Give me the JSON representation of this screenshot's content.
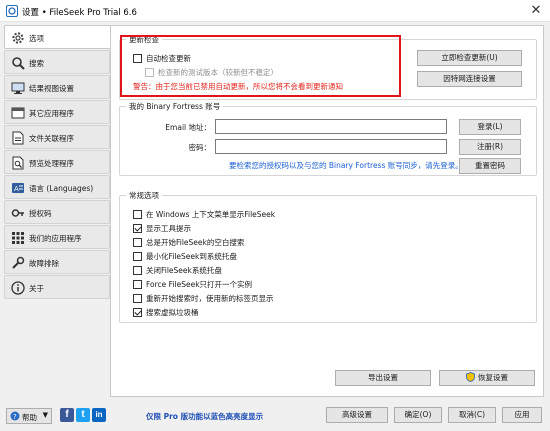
{
  "window": {
    "title": "设置 • FileSeek Pro Trial 6.6",
    "close_glyph": "✕"
  },
  "sidebar": {
    "items": [
      {
        "label": "选项",
        "icon": "gear-icon",
        "active": true
      },
      {
        "label": "搜索",
        "icon": "search-icon"
      },
      {
        "label": "结果视图设置",
        "icon": "monitor-icon"
      },
      {
        "label": "其它应用程序",
        "icon": "apps-icon"
      },
      {
        "label": "文件关联程序",
        "icon": "file-link-icon"
      },
      {
        "label": "预览处理程序",
        "icon": "preview-icon"
      },
      {
        "label": "语言 (Languages)",
        "icon": "language-icon"
      },
      {
        "label": "授权码",
        "icon": "key-icon"
      },
      {
        "label": "我们的应用程序",
        "icon": "grid-icon"
      },
      {
        "label": "故障排除",
        "icon": "troubleshoot-icon"
      },
      {
        "label": "关于",
        "icon": "info-icon"
      }
    ]
  },
  "updates": {
    "group_title": "更新检查",
    "auto_check_label": "自动检查更新",
    "auto_check_checked": false,
    "beta_label": "检查新的测试版本（较新但不稳定）",
    "beta_checked": false,
    "warning": "警告：由于您当前已禁用自动更新，所以您将不会看到更新通知",
    "check_now_button": "立即检查更新(U)",
    "proxy_button": "因特网连接设置"
  },
  "account": {
    "group_title": "我的 Binary Fortress 账号",
    "email_label": "Email 地址：",
    "email_value": "",
    "password_label": "密码：",
    "password_value": "",
    "login_button": "登录(L)",
    "register_button": "注册(R)",
    "forgot_link": "要检索您的授权码以及与您的 Binary Fortress 账号同步，请先登录。",
    "reset_password_button": "重置密码"
  },
  "general": {
    "group_title": "常规选项",
    "options": [
      {
        "label": "在 Windows 上下文菜单显示FileSeek",
        "checked": false
      },
      {
        "label": "显示工具提示",
        "checked": true
      },
      {
        "label": "总是开始FileSeek的空白搜索",
        "checked": false
      },
      {
        "label": "最小化FileSeek到系统托盘",
        "checked": false
      },
      {
        "label": "关闭FileSeek系统托盘",
        "checked": false
      },
      {
        "label": "Force FileSeek只打开一个实例",
        "checked": false
      },
      {
        "label": "重新开始搜索时，使用新的标签页显示",
        "checked": false
      },
      {
        "label": "搜索虚拟垃圾桶",
        "checked": true
      }
    ]
  },
  "content_footer": {
    "export_button": "导出设置",
    "restore_button": "恢复设置"
  },
  "bottom_bar": {
    "help_label": "帮助",
    "social": [
      {
        "name": "facebook-icon",
        "glyph": "f",
        "color": "#3b5998"
      },
      {
        "name": "twitter-icon",
        "glyph": "t",
        "color": "#1da1f2"
      },
      {
        "name": "linkedin-icon",
        "glyph": "in",
        "color": "#0a66c2"
      }
    ],
    "promo": "仅限 Pro 版功能以蓝色高亮度显示",
    "advanced_button": "高级设置",
    "ok_button": "确定(O)",
    "cancel_button": "取消(C)",
    "apply_button": "应用"
  },
  "colors": {
    "accent_blue": "#1e4fb5",
    "warning_red": "#e0231c",
    "highlight_box": "#e1141b"
  }
}
